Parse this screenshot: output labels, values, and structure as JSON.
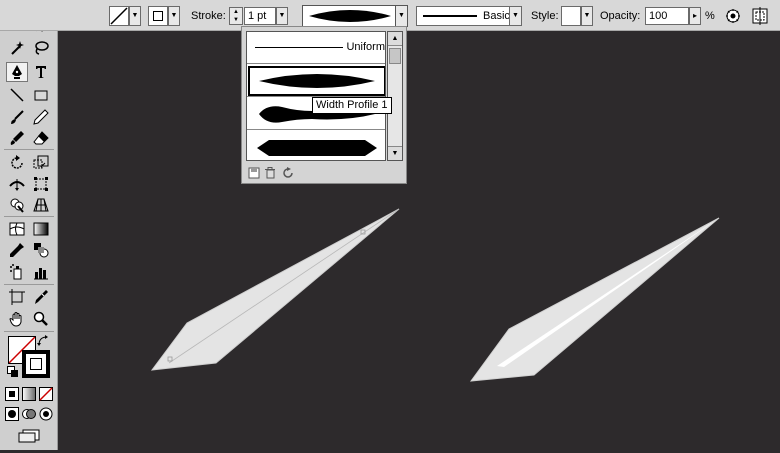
{
  "control_bar": {
    "stroke_label": "Stroke:",
    "stroke_weight": "1 pt",
    "brush_name": "Basic",
    "style_label": "Style:",
    "opacity_label": "Opacity:",
    "opacity_value": "100",
    "opacity_unit": "%"
  },
  "profile_popup": {
    "items": [
      {
        "label": "Uniform",
        "shape": "uniform"
      },
      {
        "label": "",
        "shape": "lens"
      },
      {
        "label": "",
        "shape": "bulb"
      },
      {
        "label": "",
        "shape": "hexagon"
      }
    ],
    "selected_index": 1,
    "tooltip": "Width Profile 1"
  },
  "tools": [
    "selection-tool",
    "direct-selection-tool",
    "magic-wand-tool",
    "lasso-tool",
    "pen-tool",
    "type-tool",
    "line-segment-tool",
    "rectangle-tool",
    "paintbrush-tool",
    "pencil-tool",
    "blob-brush-tool",
    "eraser-tool",
    "rotate-tool",
    "scale-tool",
    "width-tool",
    "free-transform-tool",
    "shape-builder-tool",
    "perspective-grid-tool",
    "mesh-tool",
    "gradient-tool",
    "eyedropper-tool",
    "blend-tool",
    "symbol-sprayer-tool",
    "column-graph-tool",
    "artboard-tool",
    "slice-tool",
    "hand-tool",
    "zoom-tool"
  ],
  "colors": {
    "canvas": "#2d2a2c",
    "panel": "#cfcfcf",
    "shape_fill": "#e6e6e6",
    "accent_black": "#000000"
  }
}
